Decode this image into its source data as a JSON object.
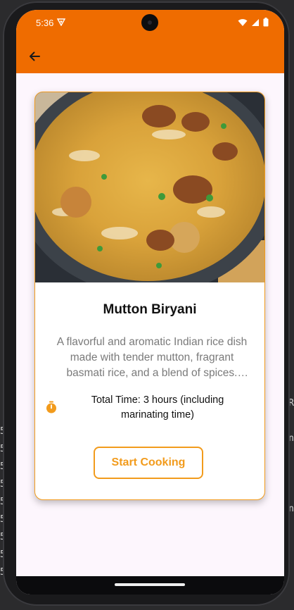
{
  "status_bar": {
    "time": "5:36",
    "icons": [
      "vpn-icon",
      "wifi-icon",
      "signal-icon",
      "battery-icon"
    ]
  },
  "app_bar": {
    "color": "#ef6c00",
    "back_icon": "arrow-left-icon"
  },
  "recipe": {
    "image": "mutton-biryani-photo",
    "title": "Mutton Biryani",
    "description": "A flavorful and aromatic Indian rice dish made with tender mutton, fragrant basmati rice, and a blend of spices. Please note thi...",
    "timer_icon": "stopwatch-icon",
    "total_time": "Total Time: 3 hours (including marinating time)",
    "start_button": "Start Cooking",
    "accent_color": "#f29b1c"
  }
}
